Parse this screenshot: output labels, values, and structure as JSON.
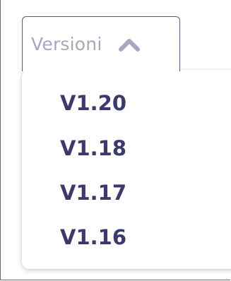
{
  "select": {
    "label": "Versioni",
    "icon": "chevron-up-icon"
  },
  "menu": {
    "items": [
      {
        "label": "V1.20"
      },
      {
        "label": "V1.18"
      },
      {
        "label": "V1.17"
      },
      {
        "label": "V1.16"
      }
    ]
  },
  "colors": {
    "accent": "#3b3872",
    "placeholder": "#a8a5c0",
    "border": "#5b5592"
  }
}
